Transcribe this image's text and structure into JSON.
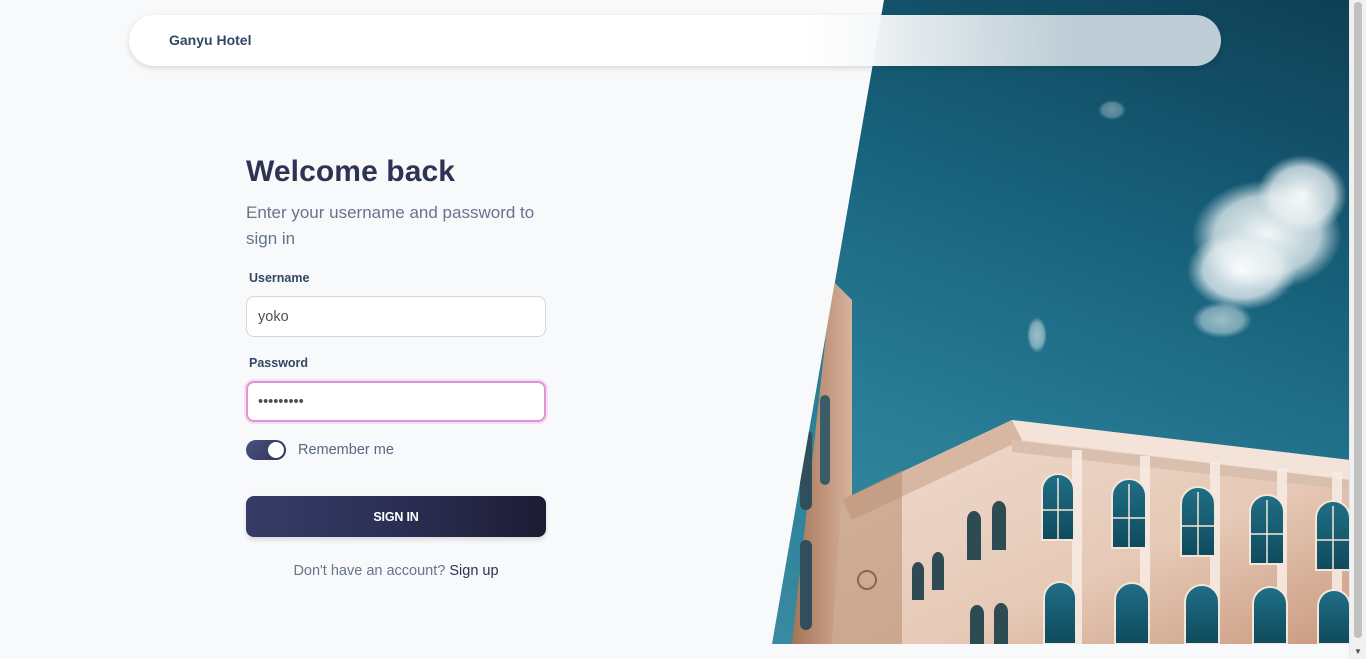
{
  "navbar": {
    "brand": "Ganyu Hotel"
  },
  "login": {
    "title": "Welcome back",
    "subtitle": "Enter your username and password to sign in",
    "username_label": "Username",
    "username_value": "yoko",
    "password_label": "Password",
    "password_value": "•••••••••",
    "remember_label": "Remember me",
    "remember_checked": true,
    "signin_label": "SIGN IN",
    "signup_prompt": "Don't have an account?",
    "signup_link": "Sign up"
  },
  "hero": {
    "icon": "hotel-building-image"
  },
  "colors": {
    "primary_dark": "#2d3353",
    "text_muted": "#67748e",
    "focus_border": "#e293d3",
    "sky": "#17607a"
  }
}
